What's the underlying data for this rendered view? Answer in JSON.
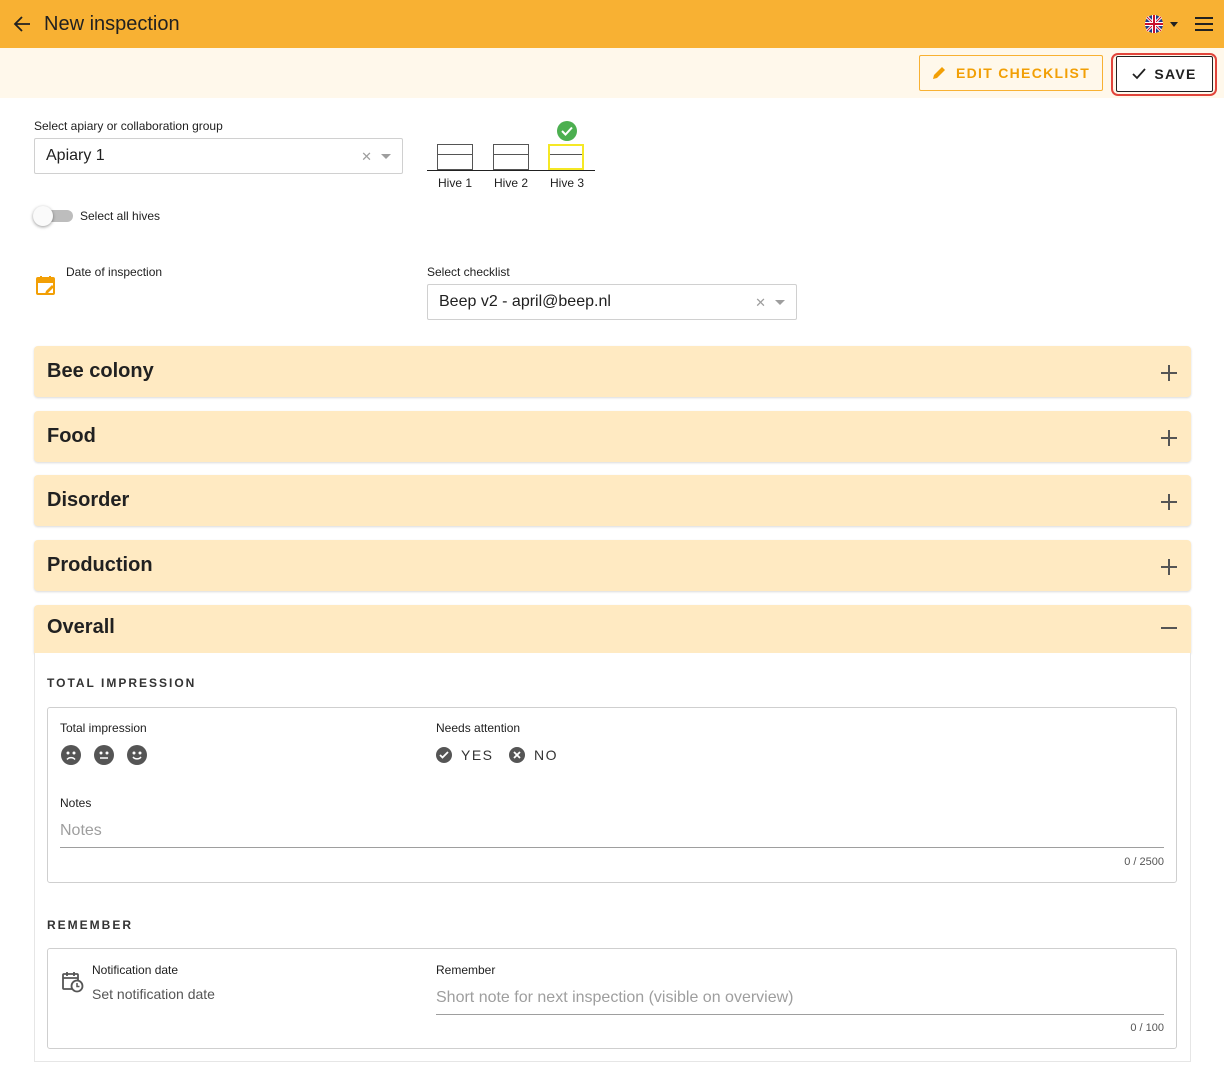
{
  "app_bar": {
    "title": "New inspection",
    "back_icon": "arrow-left-icon",
    "language_icon": "uk-flag-icon",
    "menu_icon": "hamburger-menu-icon",
    "color": "#F8B133"
  },
  "toolbar": {
    "edit_checklist_label": "EDIT CHECKLIST",
    "save_label": "SAVE"
  },
  "apiary": {
    "label": "Select apiary or collaboration group",
    "value": "Apiary 1"
  },
  "hives": [
    {
      "label": "Hive 1",
      "selected": false
    },
    {
      "label": "Hive 2",
      "selected": false
    },
    {
      "label": "Hive 3",
      "selected": true
    }
  ],
  "select_all": {
    "label": "Select all hives",
    "checked": false
  },
  "date": {
    "label": "Date of inspection"
  },
  "checklist": {
    "label": "Select checklist",
    "value": "Beep v2 - april@beep.nl"
  },
  "sections": [
    {
      "title": "Bee colony",
      "expanded": false
    },
    {
      "title": "Food",
      "expanded": false
    },
    {
      "title": "Disorder",
      "expanded": false
    },
    {
      "title": "Production",
      "expanded": false
    },
    {
      "title": "Overall",
      "expanded": true
    }
  ],
  "overall": {
    "total_impression_heading": "TOTAL IMPRESSION",
    "total_impression_label": "Total impression",
    "needs_attention_label": "Needs attention",
    "yes_label": "YES",
    "no_label": "NO",
    "notes_label": "Notes",
    "notes_placeholder": "Notes",
    "notes_counter": "0 / 2500",
    "remember_heading": "REMEMBER",
    "notification_date_label": "Notification date",
    "notification_date_placeholder": "Set notification date",
    "remember_label": "Remember",
    "remember_placeholder": "Short note for next inspection (visible on overview)",
    "remember_counter": "0 / 100"
  }
}
